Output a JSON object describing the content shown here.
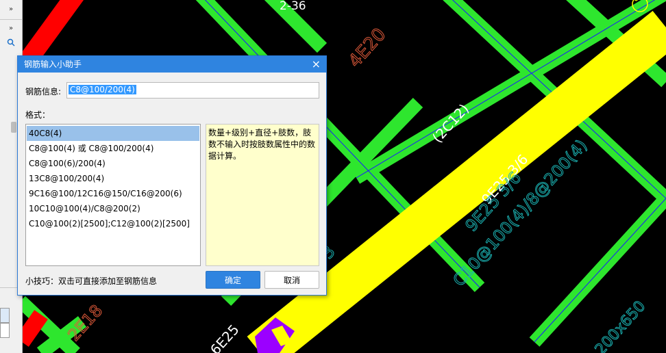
{
  "dialog": {
    "title": "钢筋输入小助手",
    "close_icon": "close-icon",
    "rebar_info_label": "钢筋信息:",
    "rebar_info_value": "C8@100/200(4)",
    "format_label": "格式：",
    "formats": [
      "40C8(4)",
      "C8@100(4) 或 C8@100/200(4)",
      "C8@100(6)/200(4)",
      "13C8@100/200(4)",
      "9C16@100/12C16@150/C16@200(6)",
      "10C10@100(4)/C8@200(2)",
      "C10@100(2)[2500];C12@100(2)[2500]"
    ],
    "selected_index": 0,
    "hint_text": "数量+级别+直径+肢数，肢数不输入时按肢数属性中的数据计算。",
    "tip_text": "小技巧：双击可直接添加至钢筋信息",
    "ok_label": "确定",
    "cancel_label": "取消"
  },
  "drawing": {
    "labels": [
      "2-36",
      "4E20",
      "(2C12)",
      "9E25 3/6",
      "9E25 3/6",
      "C10@100(4)/8@200(4)",
      "2E18",
      "6E25",
      "3",
      "200x650",
      "8"
    ],
    "colors": {
      "background": "#000000",
      "beam_green": "#2ee62e",
      "beam_yellow": "#ffff00",
      "beam_red": "#ff0000",
      "column_purple": "#9b00ff",
      "text_cyan": "#1bb3b3",
      "text_orange": "#e05a3a",
      "text_white": "#ffffff",
      "axis_blue": "#1a1aff"
    }
  },
  "left_panel": {
    "buttons": [
      "»",
      "»"
    ]
  }
}
